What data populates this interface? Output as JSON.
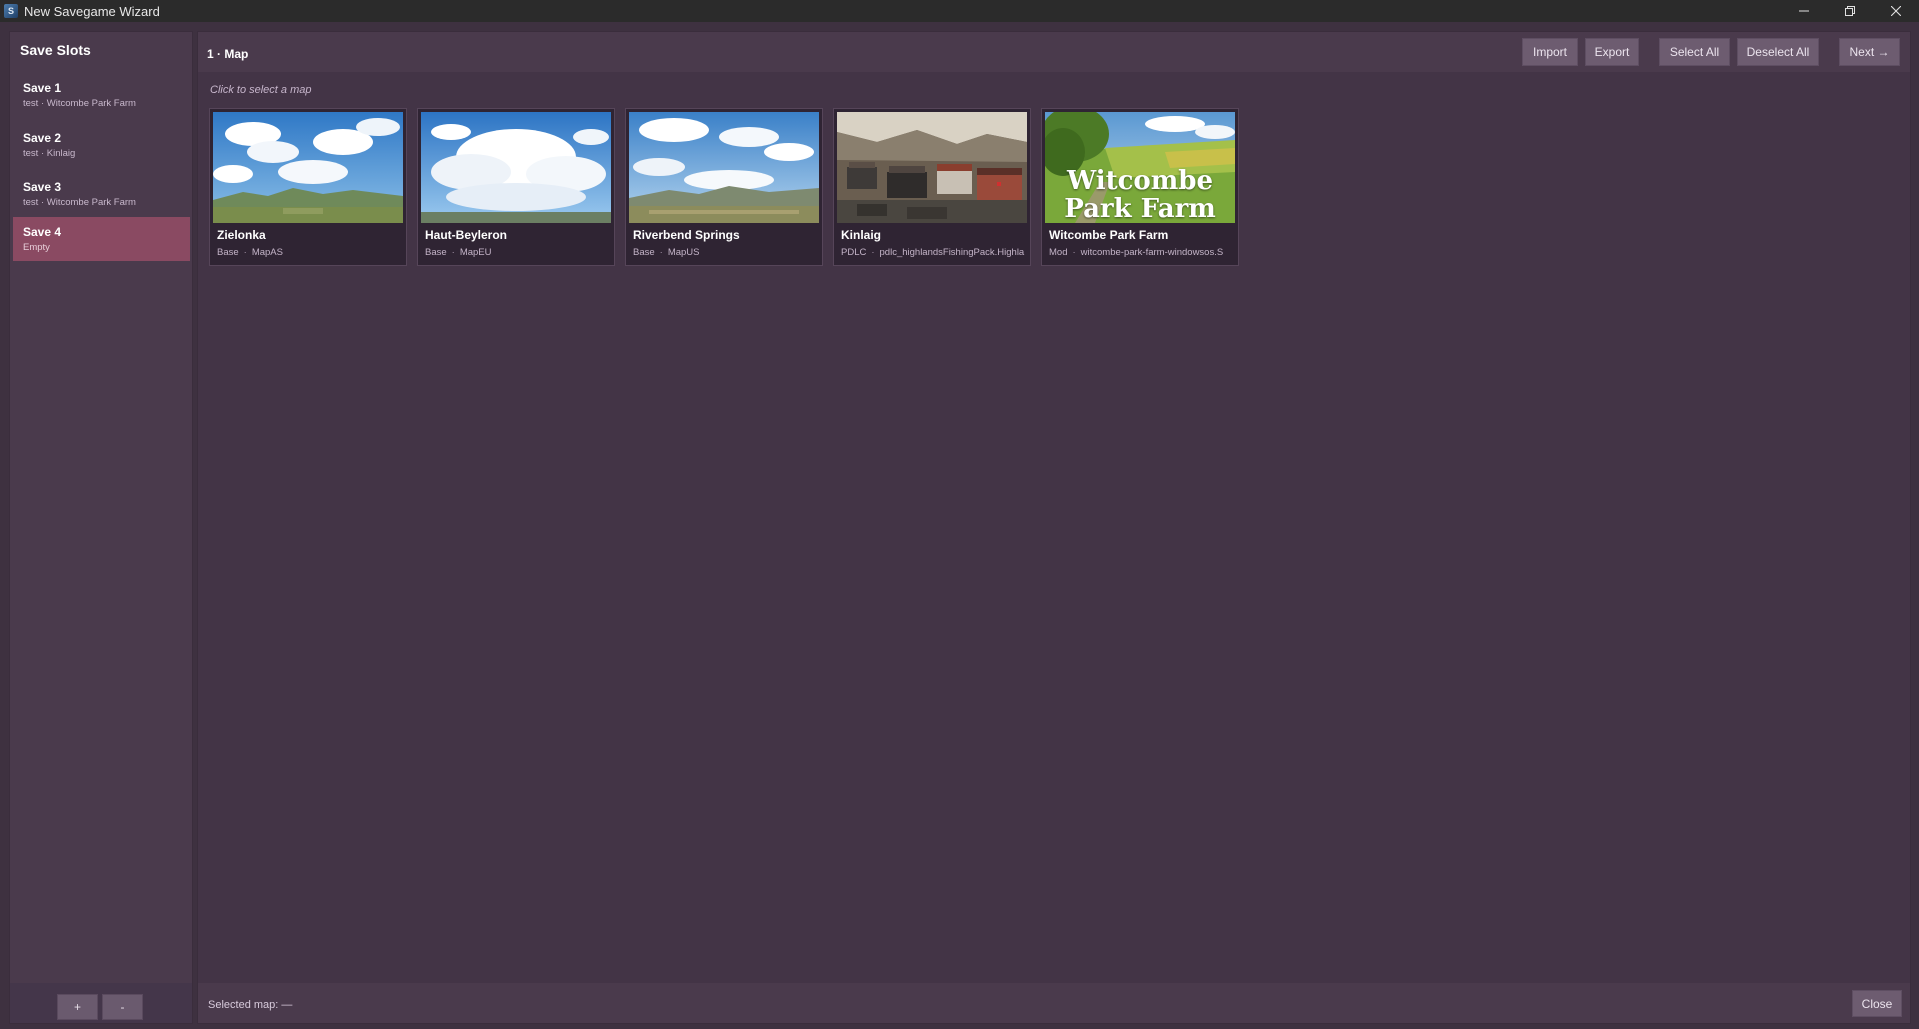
{
  "window": {
    "title": "New Savegame Wizard",
    "icon": "app-icon"
  },
  "sidebar": {
    "header": "Save Slots",
    "slots": [
      {
        "name": "Save 1",
        "sub": "test · Witcombe Park Farm",
        "selected": false
      },
      {
        "name": "Save 2",
        "sub": "test · Kinlaig",
        "selected": false
      },
      {
        "name": "Save 3",
        "sub": "test · Witcombe Park Farm",
        "selected": false
      },
      {
        "name": "Save 4",
        "sub": "Empty",
        "selected": true
      }
    ],
    "add_label": "+",
    "remove_label": "-"
  },
  "main": {
    "step_title": "1 · Map",
    "toolbar": {
      "import_label": "Import",
      "export_label": "Export",
      "select_all_label": "Select All",
      "deselect_all_label": "Deselect All",
      "next_label": "Next →"
    },
    "hint": "Click to select a map",
    "maps": [
      {
        "name": "Zielonka",
        "source": "Base",
        "id": "MapAS"
      },
      {
        "name": "Haut-Beyleron",
        "source": "Base",
        "id": "MapEU"
      },
      {
        "name": "Riverbend Springs",
        "source": "Base",
        "id": "MapUS"
      },
      {
        "name": "Kinlaig",
        "source": "PDLC",
        "id": "pdlc_highlandsFishingPack.Highla"
      },
      {
        "name": "Witcombe Park Farm",
        "source": "Mod",
        "id": "witcombe-park-farm-windowsos.S",
        "thumb_text_1": "Witcombe",
        "thumb_text_2": "Park Farm"
      }
    ],
    "footer": {
      "selected_label": "Selected map: —",
      "close_label": "Close"
    }
  },
  "colors": {
    "background": "#3e3140",
    "panel": "#4a3a4c",
    "selected_slot": "#8a4a62",
    "button": "#6d5c70",
    "card": "#2f2433"
  }
}
